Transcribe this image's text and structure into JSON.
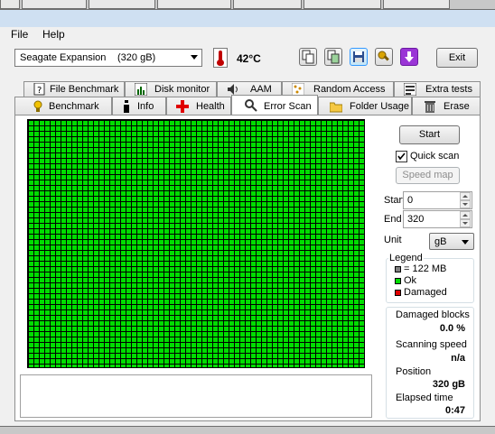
{
  "menu": {
    "file": "File",
    "help": "Help"
  },
  "drive": {
    "selected": "Seagate Expansion",
    "size": "(320 gB)"
  },
  "temperature": "42°C",
  "exit_label": "Exit",
  "tabs_row1": [
    "File Benchmark",
    "Disk monitor",
    "AAM",
    "Random Access",
    "Extra tests"
  ],
  "tabs_row2": [
    "Benchmark",
    "Info",
    "Health",
    "Error Scan",
    "Folder Usage",
    "Erase"
  ],
  "active_tab": "Error Scan",
  "scan": {
    "start_button": "Start",
    "quick_scan_label": "Quick scan",
    "quick_scan_checked": true,
    "speed_map_button": "Speed map",
    "start_label": "Start",
    "start_value": "0",
    "end_label": "End",
    "end_value": "320",
    "unit_label": "Unit",
    "unit_value": "gB"
  },
  "legend": {
    "title": "Legend",
    "block": "= 122 MB",
    "ok": "Ok",
    "damaged": "Damaged",
    "colors": {
      "block": "#808080",
      "ok": "#00dd00",
      "damaged": "#e00000"
    }
  },
  "stats": {
    "damaged_label": "Damaged blocks",
    "damaged_value": "0.0 %",
    "speed_label": "Scanning speed",
    "speed_value": "n/a",
    "position_label": "Position",
    "position_value": "320 gB",
    "elapsed_label": "Elapsed time",
    "elapsed_value": "0:47"
  },
  "colors": {
    "grid_ok": "#00dd00",
    "accent": "#3399ff"
  }
}
